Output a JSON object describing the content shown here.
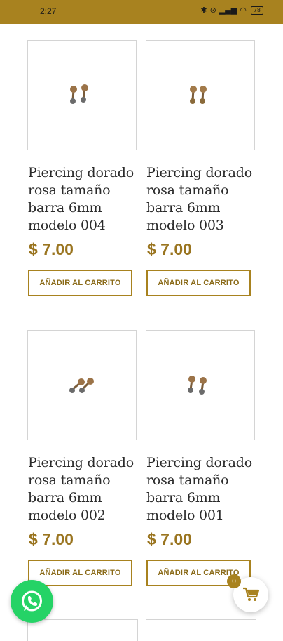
{
  "status_bar": {
    "time": "2:27",
    "battery": "78"
  },
  "products": [
    {
      "title": "Piercing dorado rosa tamaño barra 6mm modelo 004",
      "price": "$ 7.00",
      "button": "AÑADIR AL CARRITO"
    },
    {
      "title": "Piercing dorado rosa tamaño barra 6mm modelo 003",
      "price": "$ 7.00",
      "button": "AÑADIR AL CARRITO"
    },
    {
      "title": "Piercing dorado rosa tamaño barra 6mm modelo 002",
      "price": "$ 7.00",
      "button": "AÑADIR AL CARRITO"
    },
    {
      "title": "Piercing dorado rosa tamaño barra 6mm modelo 001",
      "price": "$ 7.00",
      "button": "AÑADIR AL CARRITO"
    }
  ],
  "cart": {
    "count": "0"
  },
  "icons": {
    "whatsapp": "whatsapp-icon",
    "cart": "cart-icon"
  },
  "colors": {
    "accent": "#a8821f",
    "price": "#9a7520",
    "whatsapp": "#25d366"
  }
}
